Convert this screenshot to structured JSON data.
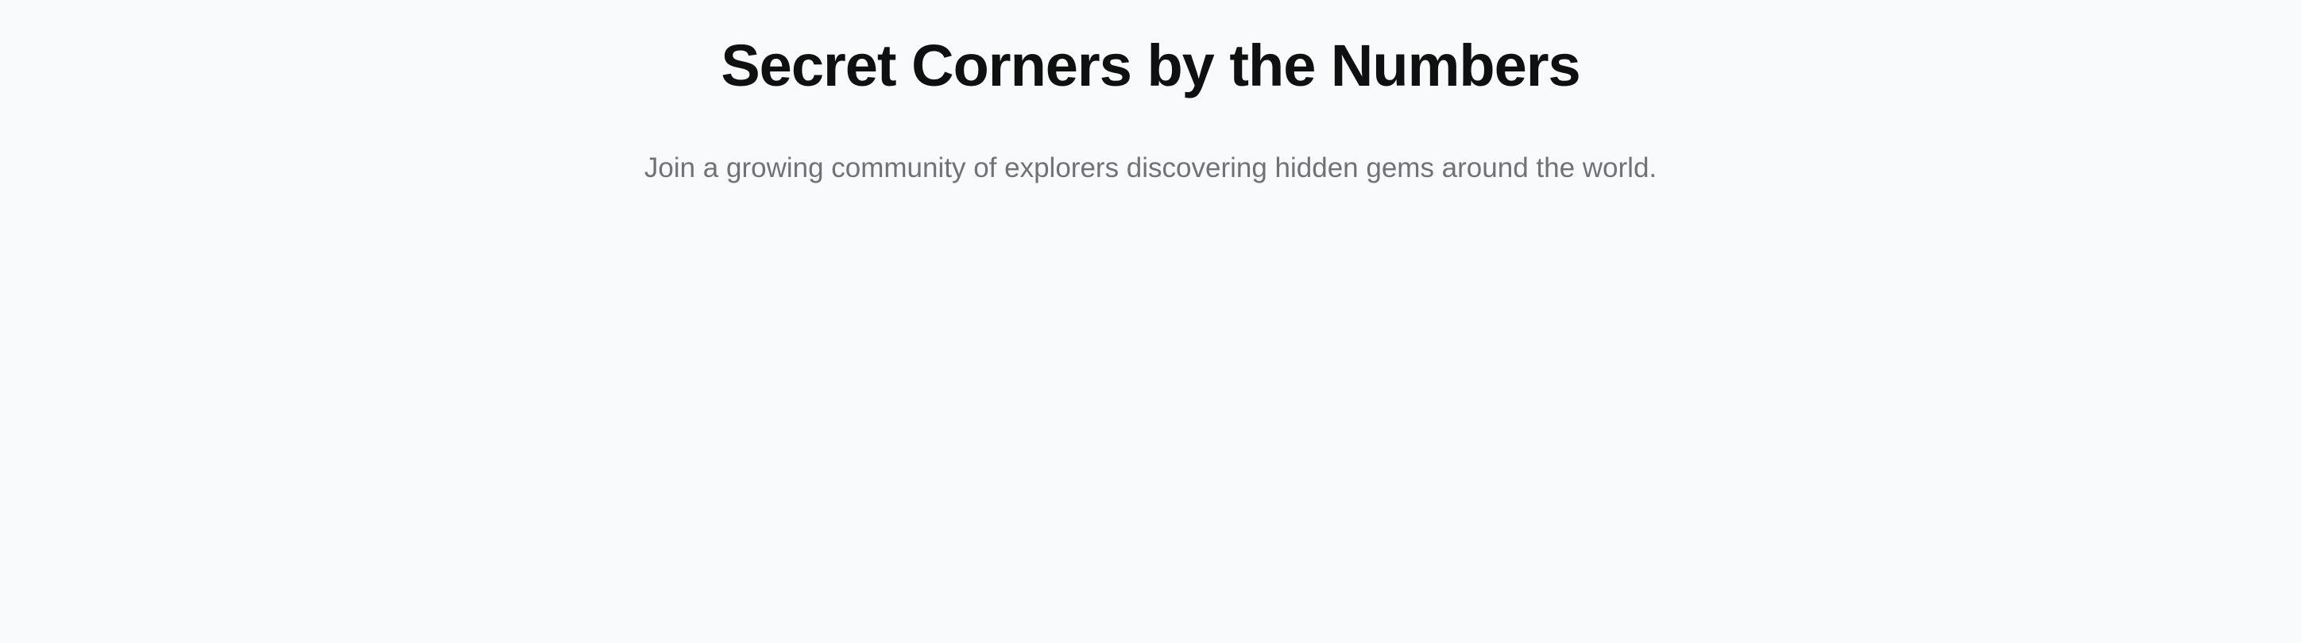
{
  "hero": {
    "title": "Secret Corners by the Numbers",
    "subtitle": "Join a growing community of explorers discovering hidden gems around the world."
  }
}
